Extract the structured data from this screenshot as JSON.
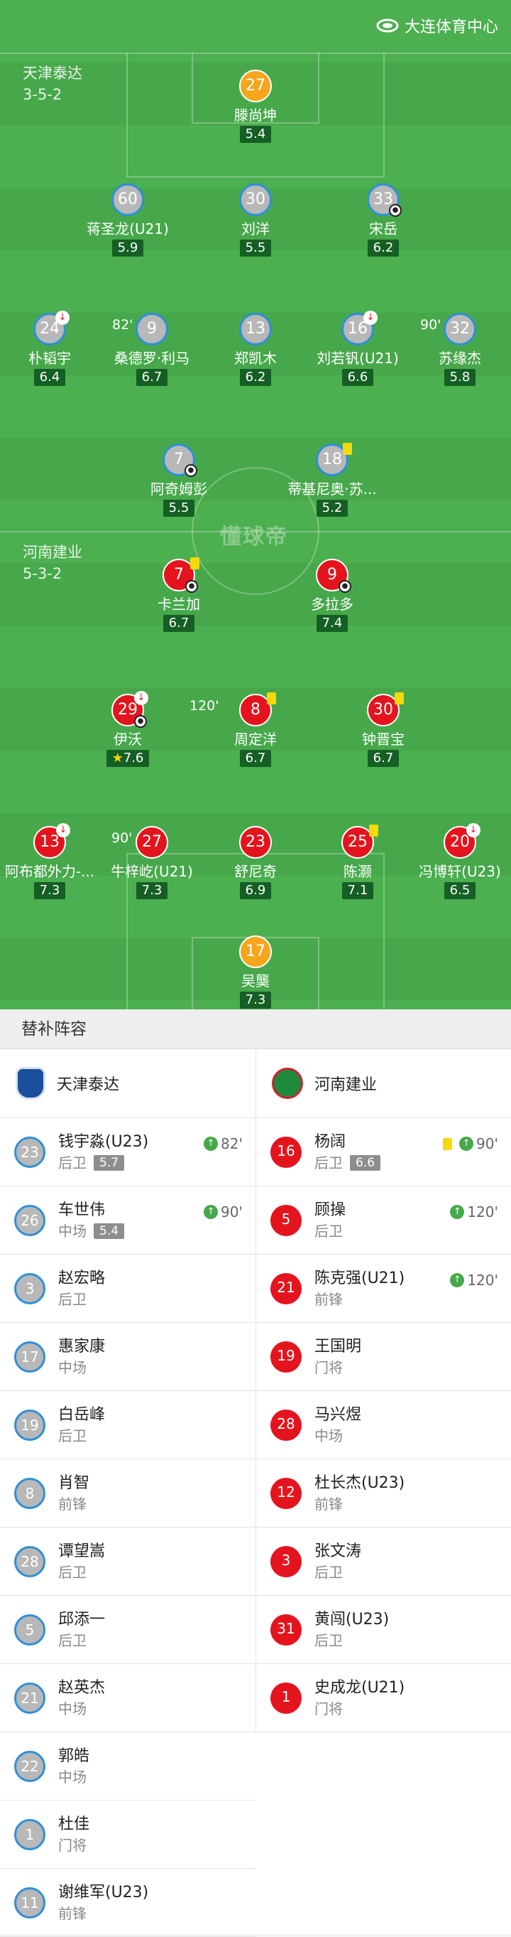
{
  "watermark": {
    "brand": "大连体育中心",
    "icon": "stadium-icon"
  },
  "center_logo": "懂球帝",
  "teams": {
    "home": {
      "name": "天津泰达",
      "formation": "3-5-2"
    },
    "away": {
      "name": "河南建业",
      "formation": "5-3-2"
    }
  },
  "lineup": {
    "home": [
      {
        "num": "27",
        "name": "滕尚坤",
        "rating": "5.4",
        "color": "gold"
      },
      {
        "num": "60",
        "name": "蒋圣龙(U21)",
        "rating": "5.9",
        "color": "grey"
      },
      {
        "num": "30",
        "name": "刘洋",
        "rating": "5.5",
        "color": "grey"
      },
      {
        "num": "33",
        "name": "宋岳",
        "rating": "6.2",
        "color": "grey",
        "ball": true
      },
      {
        "num": "24",
        "name": "朴韬宇",
        "rating": "6.4",
        "color": "grey",
        "sub": "82'"
      },
      {
        "num": "9",
        "name": "桑德罗·利马",
        "rating": "6.7",
        "color": "grey"
      },
      {
        "num": "13",
        "name": "郑凯木",
        "rating": "6.2",
        "color": "grey"
      },
      {
        "num": "16",
        "name": "刘若钒(U21)",
        "rating": "6.6",
        "color": "grey",
        "sub": "90'"
      },
      {
        "num": "32",
        "name": "苏缘杰",
        "rating": "5.8",
        "color": "grey"
      },
      {
        "num": "7",
        "name": "阿奇姆彭",
        "rating": "5.5",
        "color": "grey",
        "ball": true
      },
      {
        "num": "18",
        "name": "蒂基尼奥·苏...",
        "rating": "5.2",
        "color": "grey",
        "yellow": true
      }
    ],
    "away": [
      {
        "num": "7",
        "name": "卡兰加",
        "rating": "6.7",
        "color": "red",
        "yellow": true,
        "ball": true
      },
      {
        "num": "9",
        "name": "多拉多",
        "rating": "7.4",
        "color": "red",
        "ball": true
      },
      {
        "num": "29",
        "name": "伊沃",
        "rating": "7.6",
        "color": "red",
        "sub": "120'",
        "ball": true,
        "star": true
      },
      {
        "num": "8",
        "name": "周定洋",
        "rating": "6.7",
        "color": "red",
        "yellow": true
      },
      {
        "num": "30",
        "name": "钟晋宝",
        "rating": "6.7",
        "color": "red",
        "yellow": true
      },
      {
        "num": "13",
        "name": "阿布都外力-...",
        "rating": "7.3",
        "color": "red",
        "sub": "90'"
      },
      {
        "num": "27",
        "name": "牛梓屹(U21)",
        "rating": "7.3",
        "color": "red"
      },
      {
        "num": "23",
        "name": "舒尼奇",
        "rating": "6.9",
        "color": "red"
      },
      {
        "num": "25",
        "name": "陈灏",
        "rating": "7.1",
        "color": "red",
        "yellow": true
      },
      {
        "num": "20",
        "name": "冯博轩(U23)",
        "rating": "6.5",
        "color": "red",
        "sub": "120'"
      },
      {
        "num": "17",
        "name": "吴龑",
        "rating": "7.3",
        "color": "gold"
      }
    ]
  },
  "bench": {
    "title": "替补阵容",
    "home": [
      {
        "num": "23",
        "name": "钱宇淼(U23)",
        "pos": "后卫",
        "rating": "5.7",
        "in": "82'"
      },
      {
        "num": "26",
        "name": "车世伟",
        "pos": "中场",
        "rating": "5.4",
        "in": "90'"
      },
      {
        "num": "3",
        "name": "赵宏略",
        "pos": "后卫"
      },
      {
        "num": "17",
        "name": "惠家康",
        "pos": "中场"
      },
      {
        "num": "19",
        "name": "白岳峰",
        "pos": "后卫"
      },
      {
        "num": "8",
        "name": "肖智",
        "pos": "前锋"
      },
      {
        "num": "28",
        "name": "谭望嵩",
        "pos": "后卫"
      },
      {
        "num": "5",
        "name": "邱添一",
        "pos": "后卫"
      },
      {
        "num": "21",
        "name": "赵英杰",
        "pos": "中场"
      },
      {
        "num": "22",
        "name": "郭皓",
        "pos": "中场"
      },
      {
        "num": "1",
        "name": "杜佳",
        "pos": "门将"
      },
      {
        "num": "11",
        "name": "谢维军(U23)",
        "pos": "前锋"
      }
    ],
    "away": [
      {
        "num": "16",
        "name": "杨阔",
        "pos": "后卫",
        "rating": "6.6",
        "in": "90'",
        "yellow": true
      },
      {
        "num": "5",
        "name": "顾操",
        "pos": "后卫",
        "in": "120'"
      },
      {
        "num": "21",
        "name": "陈克强(U21)",
        "pos": "前锋",
        "in": "120'"
      },
      {
        "num": "19",
        "name": "王国明",
        "pos": "门将"
      },
      {
        "num": "28",
        "name": "马兴煜",
        "pos": "中场"
      },
      {
        "num": "12",
        "name": "杜长杰(U23)",
        "pos": "前锋"
      },
      {
        "num": "3",
        "name": "张文涛",
        "pos": "后卫"
      },
      {
        "num": "31",
        "name": "黄闯(U23)",
        "pos": "后卫"
      },
      {
        "num": "1",
        "name": "史成龙(U21)",
        "pos": "门将"
      }
    ]
  }
}
